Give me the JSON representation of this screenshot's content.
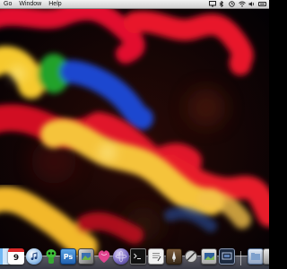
{
  "menubar": {
    "items": [
      "Go",
      "Window",
      "Help"
    ]
  },
  "dock": {
    "ical_day": "9",
    "photoshop_label": "Ps"
  },
  "colors": {
    "menubar_bg": "#e6e6e6",
    "wallpaper_red": "#e8102a",
    "wallpaper_yellow": "#f7d23a",
    "wallpaper_blue": "#1a4fd6",
    "wallpaper_green": "#2aa82a"
  }
}
